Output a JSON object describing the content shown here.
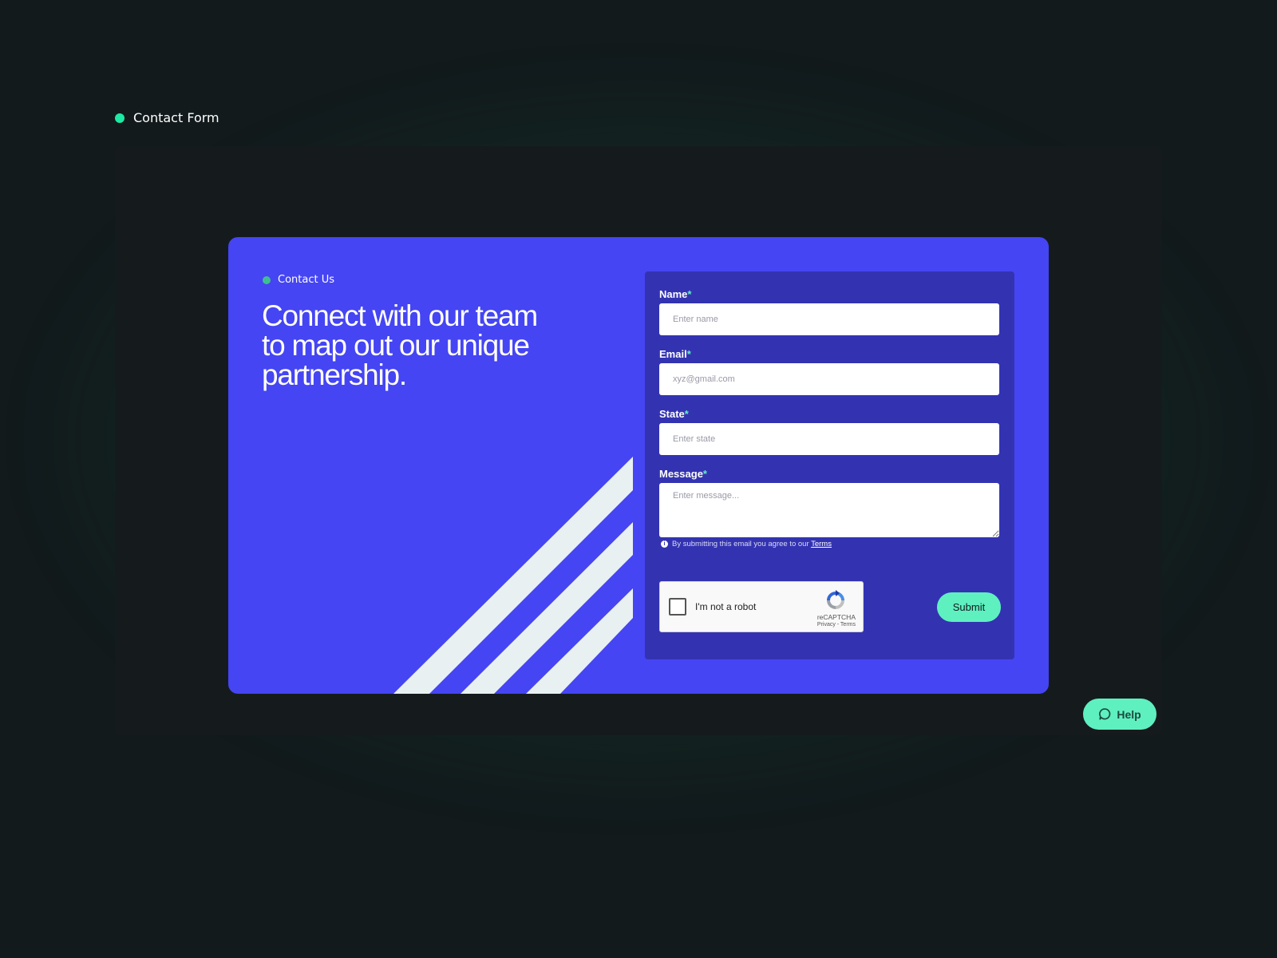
{
  "section": {
    "label": "Contact Form"
  },
  "card": {
    "eyebrow": "Contact Us",
    "headline": "Connect with our team to map out our unique partnership."
  },
  "form": {
    "fields": [
      {
        "label": "Name",
        "required_mark": "*",
        "placeholder": "Enter name"
      },
      {
        "label": "Email",
        "required_mark": "*",
        "placeholder": "xyz@gmail.com"
      },
      {
        "label": "State",
        "required_mark": "*",
        "placeholder": "Enter state"
      },
      {
        "label": "Message",
        "required_mark": "*",
        "placeholder": "Enter message..."
      }
    ],
    "disclaimer": "By submitting this email you agree to our ",
    "terms_link": "Terms",
    "recaptcha": {
      "label": "I'm not a robot",
      "brand": "reCAPTCHA",
      "links": "Privacy - Terms"
    },
    "submit_label": "Submit"
  },
  "help": {
    "label": "Help"
  },
  "colors": {
    "page_background": "#121a1c",
    "card_background": "#4545f3",
    "form_panel": "#3333b2",
    "accent": "#5ff0c0",
    "stripe": "#e8f0f2"
  },
  "icons": {
    "section_dot": "green-dot-icon",
    "info": "info-icon",
    "recaptcha": "recaptcha-logo-icon",
    "help": "chat-bubble-icon"
  }
}
